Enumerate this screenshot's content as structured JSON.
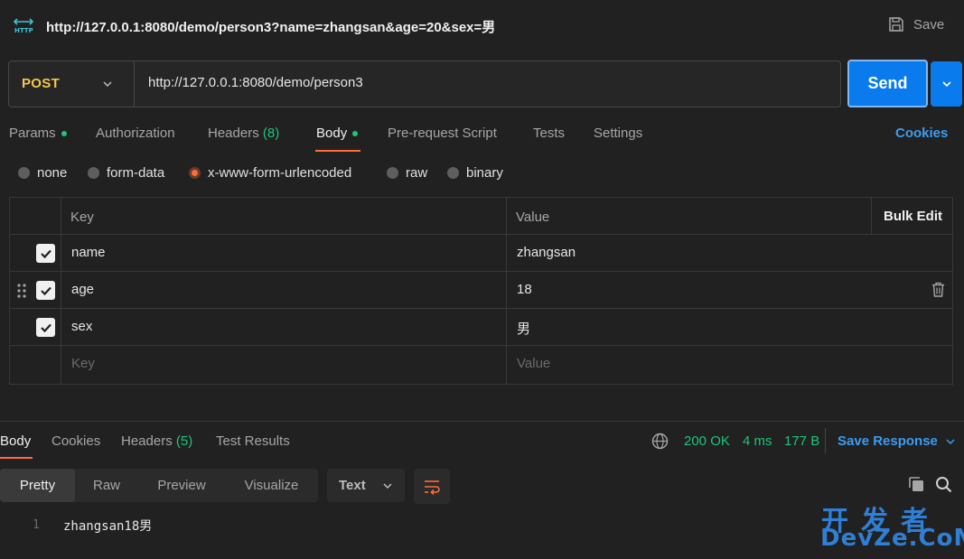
{
  "titlebar": {
    "url": "http://127.0.0.1:8080/demo/person3?name=zhangsan&age=20&sex=男",
    "save_label": "Save"
  },
  "request": {
    "method": "POST",
    "url": "http://127.0.0.1:8080/demo/person3",
    "send_label": "Send"
  },
  "request_tabs": [
    {
      "label": "Params",
      "dot": true
    },
    {
      "label": "Authorization"
    },
    {
      "label": "Headers",
      "count": "(8)"
    },
    {
      "label": "Body",
      "dot": true,
      "active": true
    },
    {
      "label": "Pre-request Script"
    },
    {
      "label": "Tests"
    },
    {
      "label": "Settings"
    }
  ],
  "cookies_label": "Cookies",
  "body_modes": [
    {
      "label": "none"
    },
    {
      "label": "form-data"
    },
    {
      "label": "x-www-form-urlencoded",
      "selected": true
    },
    {
      "label": "raw"
    },
    {
      "label": "binary"
    }
  ],
  "kv_table": {
    "headers": {
      "key": "Key",
      "value": "Value",
      "bulk_edit": "Bulk Edit"
    },
    "rows": [
      {
        "key": "name",
        "value": "zhangsan",
        "checked": true
      },
      {
        "key": "age",
        "value": "18",
        "checked": true
      },
      {
        "key": "sex",
        "value": "男",
        "checked": true
      }
    ],
    "placeholder": {
      "key": "Key",
      "value": "Value"
    }
  },
  "response": {
    "tabs": [
      {
        "label": "Body",
        "active": true
      },
      {
        "label": "Cookies"
      },
      {
        "label": "Headers",
        "count": "(5)"
      },
      {
        "label": "Test Results"
      }
    ],
    "status": "200 OK",
    "time": "4 ms",
    "size": "177 B",
    "save_response_label": "Save Response",
    "formats": [
      "Pretty",
      "Raw",
      "Preview",
      "Visualize"
    ],
    "active_format": "Pretty",
    "language": "Text",
    "line_number": "1",
    "body": "zhangsan18男"
  },
  "watermark": {
    "cn": "开发者",
    "en": "DevZe.CoM"
  },
  "colors": {
    "accent_orange": "#ff6c37",
    "send_blue": "#097bed",
    "status_green": "#1ec47a",
    "method_yellow": "#f2c94c",
    "link_blue": "#3d9cf0"
  }
}
